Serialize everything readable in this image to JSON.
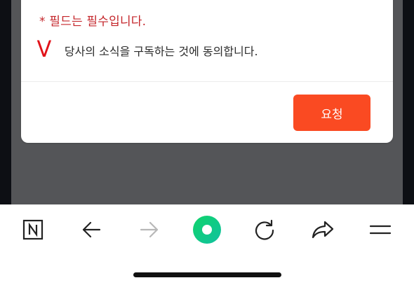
{
  "modal": {
    "required_note": "* 필드는 필수입니다.",
    "consent_mark": "V",
    "consent_text": "당사의 소식을 구독하는 것에 동의합니다.",
    "request_button_label": "요청"
  },
  "toolbar": {
    "items": [
      {
        "name": "naver-home",
        "icon": "n-square-icon"
      },
      {
        "name": "back",
        "icon": "arrow-left-icon"
      },
      {
        "name": "forward",
        "icon": "arrow-right-icon",
        "state": "disabled"
      },
      {
        "name": "green-dot",
        "icon": "green-dot-icon"
      },
      {
        "name": "reload",
        "icon": "reload-icon"
      },
      {
        "name": "share",
        "icon": "share-icon"
      },
      {
        "name": "menu",
        "icon": "menu-icon"
      }
    ]
  },
  "colors": {
    "accent_button": "#fa4a22",
    "required_text": "#c4262b",
    "check_mark": "#e1131a",
    "green_button": "#19c37d",
    "backdrop": "#545558"
  }
}
